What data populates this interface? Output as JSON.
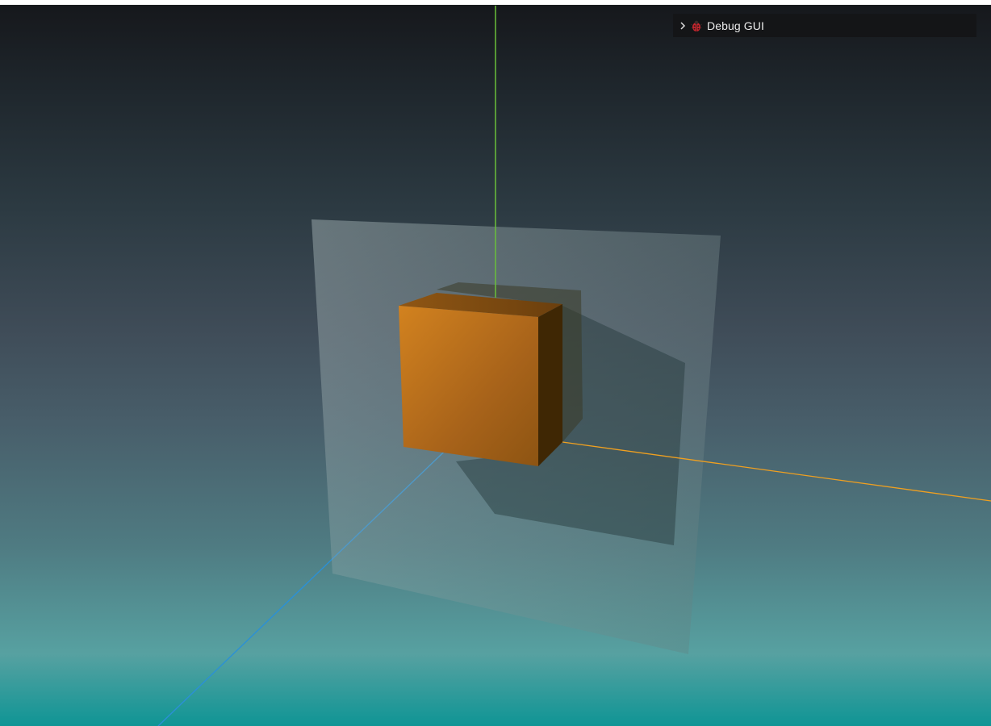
{
  "debug_gui": {
    "title": "Debug GUI",
    "collapsed": true,
    "chevron_icon": "chevron-right-icon",
    "emoji_icon": "ladybug-icon"
  },
  "scene": {
    "background_top": "#16181c",
    "background_bottom": "#0f9595",
    "axes": {
      "x_color": "#f0a020",
      "y_color": "#6abf3a",
      "z_color": "#2a8fd4"
    },
    "cube_color": "#c8761a",
    "plane_color": "#8a9ea0"
  }
}
